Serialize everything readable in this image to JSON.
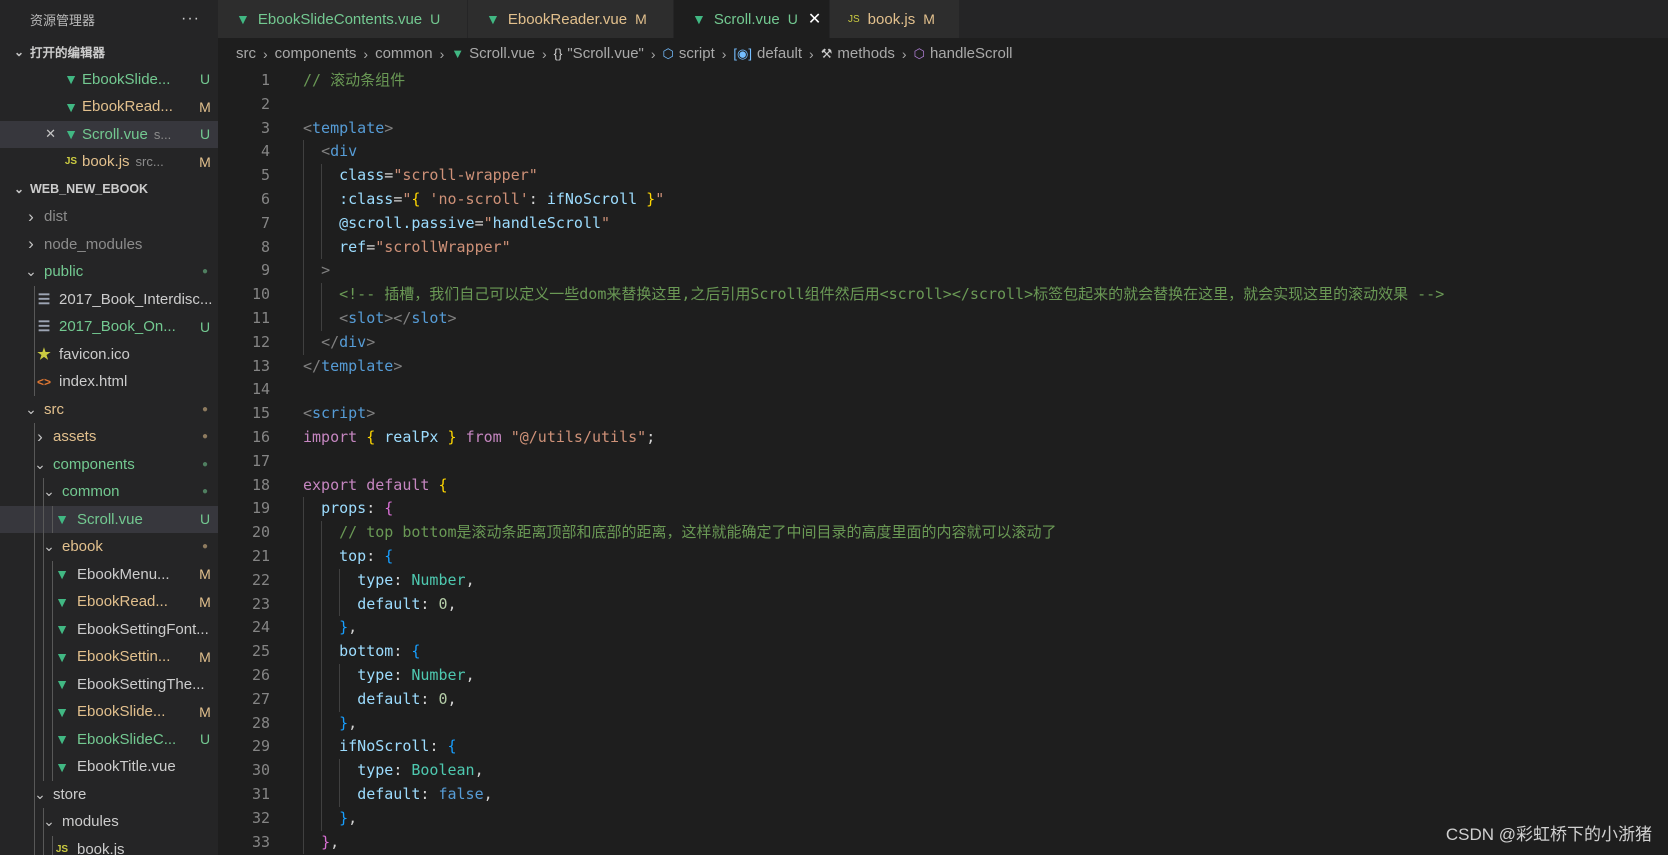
{
  "sidebar": {
    "title": "资源管理器",
    "more": "···",
    "open_editors_label": "打开的编辑器",
    "open_editors": [
      {
        "name": "EbookSlide...",
        "status": "U",
        "icon": "vue-icon",
        "color": "green",
        "close": false
      },
      {
        "name": "EbookRead...",
        "status": "M",
        "icon": "vue-icon",
        "color": "yellow",
        "close": false
      },
      {
        "name": "Scroll.vue",
        "extra": "s...",
        "status": "U",
        "icon": "vue-icon",
        "color": "green",
        "close": true
      },
      {
        "name": "book.js",
        "extra": "src...",
        "status": "M",
        "icon": "js-icon",
        "color": "yellow",
        "close": false
      }
    ],
    "project_label": "WEB_NEW_EBOOK",
    "tree": [
      {
        "name": "dist",
        "depth": 0,
        "chevron": "right",
        "icon": "",
        "color": "dim"
      },
      {
        "name": "node_modules",
        "depth": 0,
        "chevron": "right",
        "icon": "",
        "color": "dim"
      },
      {
        "name": "public",
        "depth": 0,
        "chevron": "down",
        "icon": "",
        "color": "green",
        "dot": "g"
      },
      {
        "name": "2017_Book_Interdisc...",
        "depth": 1,
        "icon": "txt-icon",
        "color": "white"
      },
      {
        "name": "2017_Book_On...",
        "depth": 1,
        "icon": "txt-icon",
        "color": "green",
        "status": "U"
      },
      {
        "name": "favicon.ico",
        "depth": 1,
        "icon": "star-icon",
        "color": "white"
      },
      {
        "name": "index.html",
        "depth": 1,
        "icon": "html-icon",
        "color": "white"
      },
      {
        "name": "src",
        "depth": 0,
        "chevron": "down",
        "icon": "",
        "color": "yellow",
        "dot": "y"
      },
      {
        "name": "assets",
        "depth": 1,
        "chevron": "right",
        "icon": "",
        "color": "yellow",
        "dot": "y"
      },
      {
        "name": "components",
        "depth": 1,
        "chevron": "down",
        "icon": "",
        "color": "green",
        "dot": "g"
      },
      {
        "name": "common",
        "depth": 2,
        "chevron": "down",
        "icon": "",
        "color": "green",
        "dot": "g"
      },
      {
        "name": "Scroll.vue",
        "depth": 3,
        "icon": "vue-icon",
        "color": "green",
        "status": "U",
        "selected": true
      },
      {
        "name": "ebook",
        "depth": 2,
        "chevron": "down",
        "icon": "",
        "color": "yellow",
        "dot": "y"
      },
      {
        "name": "EbookMenu...",
        "depth": 3,
        "icon": "vue-icon",
        "color": "white",
        "status": "M"
      },
      {
        "name": "EbookRead...",
        "depth": 3,
        "icon": "vue-icon",
        "color": "yellow",
        "status": "M"
      },
      {
        "name": "EbookSettingFont...",
        "depth": 3,
        "icon": "vue-icon",
        "color": "white"
      },
      {
        "name": "EbookSettin...",
        "depth": 3,
        "icon": "vue-icon",
        "color": "yellow",
        "status": "M"
      },
      {
        "name": "EbookSettingThe...",
        "depth": 3,
        "icon": "vue-icon",
        "color": "white"
      },
      {
        "name": "EbookSlide...",
        "depth": 3,
        "icon": "vue-icon",
        "color": "yellow",
        "status": "M"
      },
      {
        "name": "EbookSlideC...",
        "depth": 3,
        "icon": "vue-icon",
        "color": "green",
        "status": "U"
      },
      {
        "name": "EbookTitle.vue",
        "depth": 3,
        "icon": "vue-icon",
        "color": "white"
      },
      {
        "name": "store",
        "depth": 1,
        "chevron": "down",
        "icon": "",
        "color": "white"
      },
      {
        "name": "modules",
        "depth": 2,
        "chevron": "down",
        "icon": "",
        "color": "white"
      },
      {
        "name": "book.js",
        "depth": 3,
        "icon": "js-icon",
        "color": "white"
      }
    ]
  },
  "tabs": [
    {
      "name": "EbookSlideContents.vue",
      "status": "U",
      "icon": "vue-icon",
      "color": "green",
      "active": false
    },
    {
      "name": "EbookReader.vue",
      "status": "M",
      "icon": "vue-icon",
      "color": "yellow",
      "active": false
    },
    {
      "name": "Scroll.vue",
      "status": "U",
      "icon": "vue-icon",
      "color": "green",
      "active": true,
      "close": "✕"
    },
    {
      "name": "book.js",
      "status": "M",
      "icon": "js-icon",
      "color": "yellow",
      "active": false
    }
  ],
  "breadcrumb": [
    {
      "label": "src",
      "icon": ""
    },
    {
      "label": "components",
      "icon": ""
    },
    {
      "label": "common",
      "icon": ""
    },
    {
      "label": "Scroll.vue",
      "icon": "vue-icon"
    },
    {
      "label": "\"Scroll.vue\"",
      "icon": "braces-icon"
    },
    {
      "label": "script",
      "icon": "cube-icon"
    },
    {
      "label": "default",
      "icon": "field-icon"
    },
    {
      "label": "methods",
      "icon": "wrench-icon"
    },
    {
      "label": "handleScroll",
      "icon": "cube-icon"
    }
  ],
  "code": [
    {
      "n": "1",
      "indent": 0,
      "tokens": [
        [
          "cm",
          "// 滚动条组件"
        ]
      ]
    },
    {
      "n": "2",
      "indent": 0,
      "tokens": []
    },
    {
      "n": "3",
      "indent": 0,
      "tokens": [
        [
          "br",
          "<"
        ],
        [
          "tag",
          "template"
        ],
        [
          "br",
          ">"
        ]
      ]
    },
    {
      "n": "4",
      "indent": 1,
      "tokens": [
        [
          "br",
          "<"
        ],
        [
          "tag",
          "div"
        ]
      ]
    },
    {
      "n": "5",
      "indent": 2,
      "tokens": [
        [
          "attr",
          "class"
        ],
        [
          "txt",
          "="
        ],
        [
          "str",
          "\"scroll-wrapper\""
        ]
      ]
    },
    {
      "n": "6",
      "indent": 2,
      "tokens": [
        [
          "attr",
          ":class"
        ],
        [
          "txt",
          "="
        ],
        [
          "str",
          "\""
        ],
        [
          "b1",
          "{"
        ],
        [
          "str",
          " 'no-scroll'"
        ],
        [
          "txt",
          ": "
        ],
        [
          "var",
          "ifNoScroll"
        ],
        [
          "b1",
          " }"
        ],
        [
          "str",
          "\""
        ]
      ]
    },
    {
      "n": "7",
      "indent": 2,
      "tokens": [
        [
          "attr",
          "@scroll.passive"
        ],
        [
          "txt",
          "="
        ],
        [
          "str",
          "\""
        ],
        [
          "var",
          "handleScroll"
        ],
        [
          "str",
          "\""
        ]
      ]
    },
    {
      "n": "8",
      "indent": 2,
      "tokens": [
        [
          "attr",
          "ref"
        ],
        [
          "txt",
          "="
        ],
        [
          "str",
          "\"scrollWrapper\""
        ]
      ]
    },
    {
      "n": "9",
      "indent": 1,
      "tokens": [
        [
          "br",
          ">"
        ]
      ]
    },
    {
      "n": "10",
      "indent": 2,
      "tokens": [
        [
          "cm",
          "<!-- 插槽，我们自己可以定义一些dom来替换这里,之后引用Scroll组件然后用<scroll></scroll>标签包起来的就会替换在这里，就会实现这里的滚动效果 -->"
        ]
      ]
    },
    {
      "n": "11",
      "indent": 2,
      "tokens": [
        [
          "br",
          "<"
        ],
        [
          "tag",
          "slot"
        ],
        [
          "br",
          "></"
        ],
        [
          "tag",
          "slot"
        ],
        [
          "br",
          ">"
        ]
      ]
    },
    {
      "n": "12",
      "indent": 1,
      "tokens": [
        [
          "br",
          "</"
        ],
        [
          "tag",
          "div"
        ],
        [
          "br",
          ">"
        ]
      ]
    },
    {
      "n": "13",
      "indent": 0,
      "tokens": [
        [
          "br",
          "</"
        ],
        [
          "tag",
          "template"
        ],
        [
          "br",
          ">"
        ]
      ]
    },
    {
      "n": "14",
      "indent": 0,
      "tokens": []
    },
    {
      "n": "15",
      "indent": 0,
      "tokens": [
        [
          "br",
          "<"
        ],
        [
          "tag",
          "script"
        ],
        [
          "br",
          ">"
        ]
      ]
    },
    {
      "n": "16",
      "indent": 0,
      "tokens": [
        [
          "kw",
          "import"
        ],
        [
          "txt",
          " "
        ],
        [
          "b1",
          "{"
        ],
        [
          "txt",
          " "
        ],
        [
          "var",
          "realPx"
        ],
        [
          "txt",
          " "
        ],
        [
          "b1",
          "}"
        ],
        [
          "txt",
          " "
        ],
        [
          "kw",
          "from"
        ],
        [
          "txt",
          " "
        ],
        [
          "str",
          "\"@/utils/utils\""
        ],
        [
          "txt",
          ";"
        ]
      ]
    },
    {
      "n": "17",
      "indent": 0,
      "tokens": []
    },
    {
      "n": "18",
      "indent": 0,
      "tokens": [
        [
          "kw",
          "export"
        ],
        [
          "txt",
          " "
        ],
        [
          "kw",
          "default"
        ],
        [
          "txt",
          " "
        ],
        [
          "b1",
          "{"
        ]
      ]
    },
    {
      "n": "19",
      "indent": 1,
      "tokens": [
        [
          "prop",
          "props"
        ],
        [
          "txt",
          ": "
        ],
        [
          "b2",
          "{"
        ]
      ]
    },
    {
      "n": "20",
      "indent": 2,
      "tokens": [
        [
          "cm",
          "// top bottom是滚动条距离顶部和底部的距离，这样就能确定了中间目录的高度里面的内容就可以滚动了"
        ]
      ]
    },
    {
      "n": "21",
      "indent": 2,
      "tokens": [
        [
          "prop",
          "top"
        ],
        [
          "txt",
          ": "
        ],
        [
          "b3",
          "{"
        ]
      ]
    },
    {
      "n": "22",
      "indent": 3,
      "tokens": [
        [
          "prop",
          "type"
        ],
        [
          "txt",
          ": "
        ],
        [
          "type",
          "Number"
        ],
        [
          "txt",
          ","
        ]
      ]
    },
    {
      "n": "23",
      "indent": 3,
      "tokens": [
        [
          "prop",
          "default"
        ],
        [
          "txt",
          ": "
        ],
        [
          "num",
          "0"
        ],
        [
          "txt",
          ","
        ]
      ]
    },
    {
      "n": "24",
      "indent": 2,
      "tokens": [
        [
          "b3",
          "}"
        ],
        [
          "txt",
          ","
        ]
      ]
    },
    {
      "n": "25",
      "indent": 2,
      "tokens": [
        [
          "prop",
          "bottom"
        ],
        [
          "txt",
          ": "
        ],
        [
          "b3",
          "{"
        ]
      ]
    },
    {
      "n": "26",
      "indent": 3,
      "tokens": [
        [
          "prop",
          "type"
        ],
        [
          "txt",
          ": "
        ],
        [
          "type",
          "Number"
        ],
        [
          "txt",
          ","
        ]
      ]
    },
    {
      "n": "27",
      "indent": 3,
      "tokens": [
        [
          "prop",
          "default"
        ],
        [
          "txt",
          ": "
        ],
        [
          "num",
          "0"
        ],
        [
          "txt",
          ","
        ]
      ]
    },
    {
      "n": "28",
      "indent": 2,
      "tokens": [
        [
          "b3",
          "}"
        ],
        [
          "txt",
          ","
        ]
      ]
    },
    {
      "n": "29",
      "indent": 2,
      "tokens": [
        [
          "prop",
          "ifNoScroll"
        ],
        [
          "txt",
          ": "
        ],
        [
          "b3",
          "{"
        ]
      ]
    },
    {
      "n": "30",
      "indent": 3,
      "tokens": [
        [
          "prop",
          "type"
        ],
        [
          "txt",
          ": "
        ],
        [
          "type",
          "Boolean"
        ],
        [
          "txt",
          ","
        ]
      ]
    },
    {
      "n": "31",
      "indent": 3,
      "tokens": [
        [
          "prop",
          "default"
        ],
        [
          "txt",
          ": "
        ],
        [
          "kw2",
          "false"
        ],
        [
          "txt",
          ","
        ]
      ]
    },
    {
      "n": "32",
      "indent": 2,
      "tokens": [
        [
          "b3",
          "}"
        ],
        [
          "txt",
          ","
        ]
      ]
    },
    {
      "n": "33",
      "indent": 1,
      "tokens": [
        [
          "b2",
          "}"
        ],
        [
          "txt",
          ","
        ]
      ]
    }
  ],
  "watermark": "CSDN @彩虹桥下的小浙猪"
}
